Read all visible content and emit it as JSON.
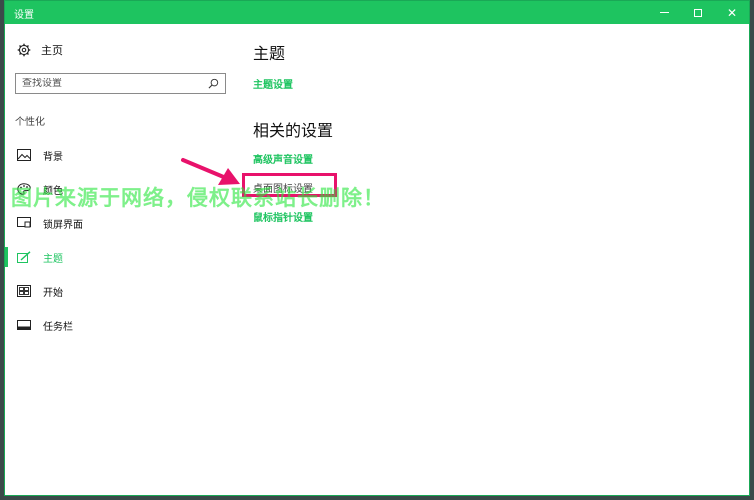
{
  "window": {
    "title": "设置",
    "controls": {
      "minimize": "",
      "maximize": "",
      "close": "✕"
    }
  },
  "sidebar": {
    "home": "主页",
    "search_placeholder": "查找设置",
    "section": "个性化",
    "items": [
      {
        "label": "背景",
        "icon": "image-icon"
      },
      {
        "label": "颜色",
        "icon": "palette-icon"
      },
      {
        "label": "锁屏界面",
        "icon": "lockscreen-icon"
      },
      {
        "label": "主题",
        "icon": "theme-brush-icon",
        "active": true
      },
      {
        "label": "开始",
        "icon": "start-grid-icon"
      },
      {
        "label": "任务栏",
        "icon": "taskbar-icon"
      }
    ]
  },
  "main": {
    "heading": "主题",
    "theme_settings_link": "主题设置",
    "related_heading": "相关的设置",
    "links": [
      "高级声音设置",
      "桌面图标设置",
      "鼠标指针设置"
    ]
  },
  "overlay": {
    "watermark": "图片来源于网络，侵权联系站长删除！"
  },
  "colors": {
    "accent": "#1ec460",
    "highlight": "#e8126b"
  }
}
